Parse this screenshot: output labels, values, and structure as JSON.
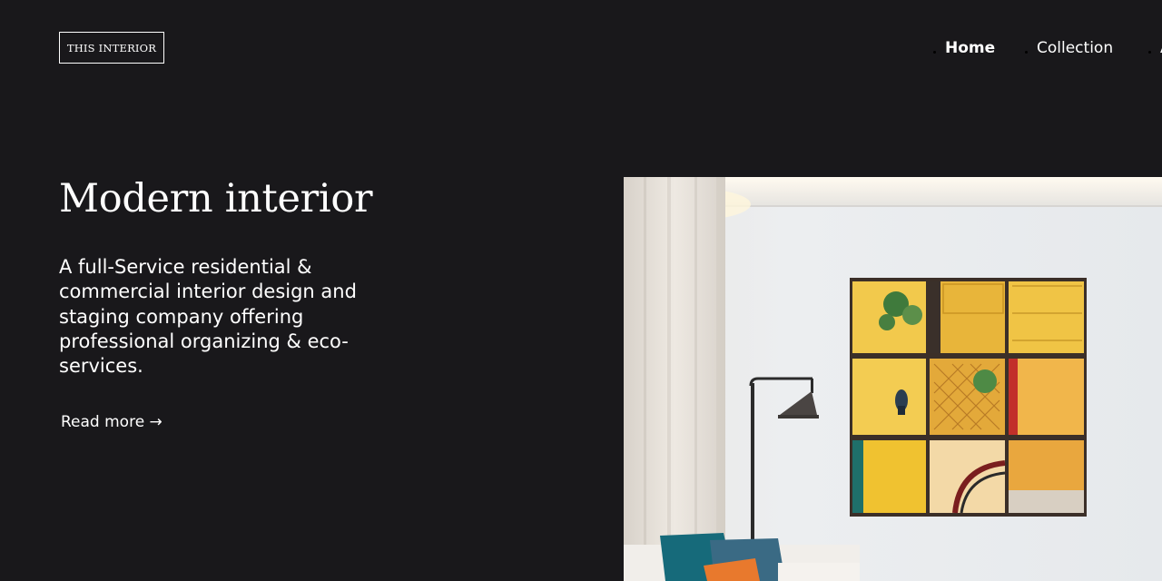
{
  "header": {
    "logo_text": "THIS INTERIOR",
    "nav": [
      {
        "label": "Home",
        "active": true
      },
      {
        "label": "Collection",
        "active": false
      },
      {
        "label": "A",
        "active": false
      }
    ]
  },
  "hero": {
    "title": "Modern interior",
    "description": "A full-Service residential & commercial interior design and staging company offering professional organizing & eco-services.",
    "read_more": "Read more →"
  },
  "colors": {
    "background": "#19181b",
    "text": "#ffffff",
    "art_yellow": "#f1c232"
  }
}
